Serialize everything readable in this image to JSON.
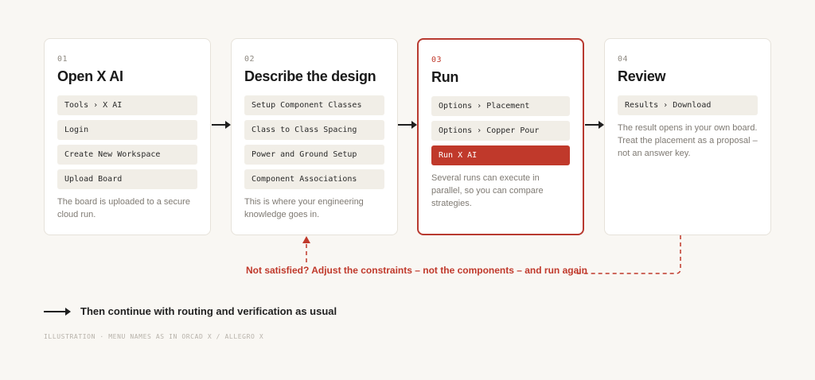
{
  "steps": [
    {
      "number": "01",
      "title": "Open X AI",
      "items": [
        "Tools › X AI",
        "Login",
        "Create New Workspace",
        "Upload Board"
      ],
      "description": "The board is uploaded to a secure cloud run."
    },
    {
      "number": "02",
      "title": "Describe the design",
      "items": [
        "Setup Component Classes",
        "Class to Class Spacing",
        "Power and Ground Setup",
        "Component Associations"
      ],
      "description": "This is where your engineering knowledge goes in."
    },
    {
      "number": "03",
      "title": "Run",
      "items": [
        "Options › Placement",
        "Options › Copper Pour"
      ],
      "primary_item": "Run X AI",
      "description": "Several runs can execute in parallel, so you can compare strategies."
    },
    {
      "number": "04",
      "title": "Review",
      "items": [
        "Results › Download"
      ],
      "description": "The result opens in your own board. Treat the placement as a proposal – not an answer key."
    }
  ],
  "feedback_loop": "Not satisfied? Adjust the constraints – not the components – and run again",
  "legend": "Then continue with routing and verification as usual",
  "footnote": "ILLUSTRATION · MENU NAMES AS IN ORCAD X / ALLEGRO X",
  "colors": {
    "accent": "#c0392b",
    "card_border": "#e6e2da",
    "item_bg": "#f1eee7",
    "background": "#f9f7f3"
  }
}
